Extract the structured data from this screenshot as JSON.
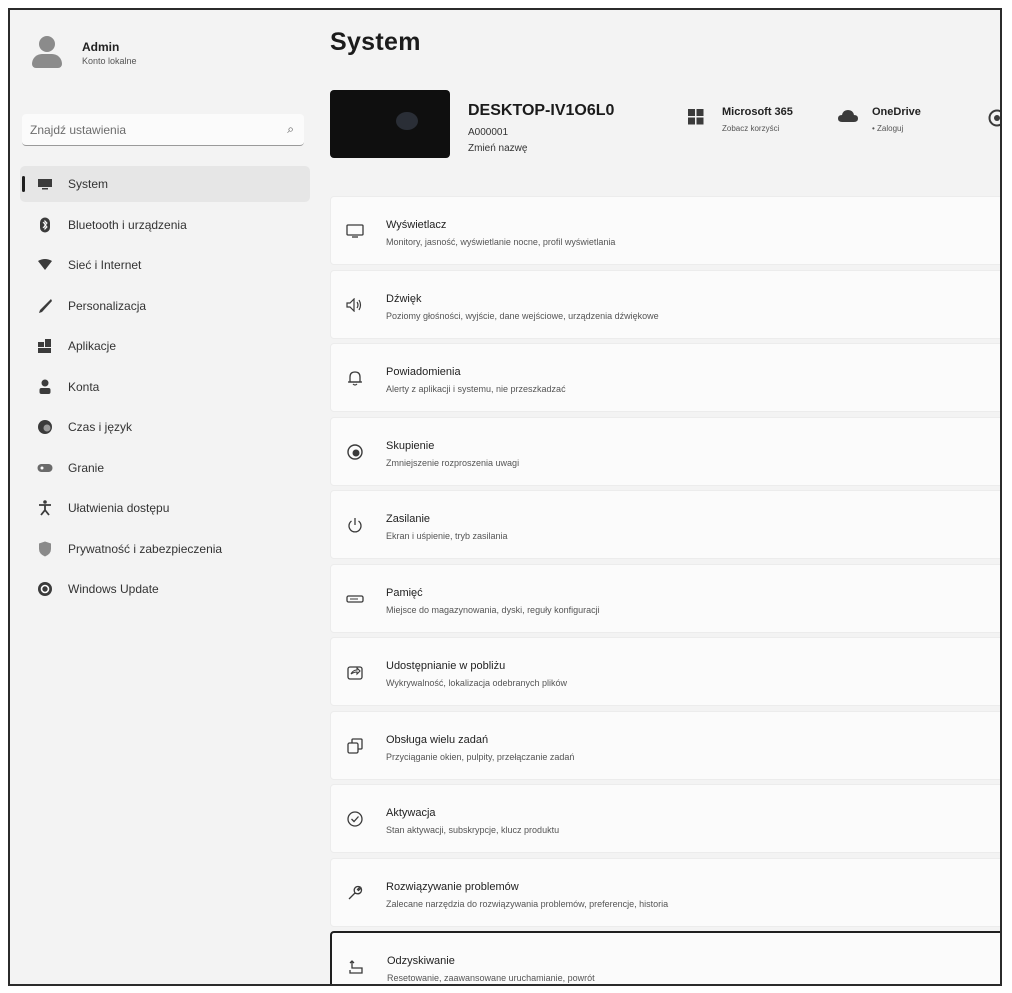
{
  "user": {
    "name": "Admin",
    "account": "Konto lokalne"
  },
  "search": {
    "placeholder": "Znajdź ustawienia"
  },
  "sidebar": {
    "items": [
      {
        "label": "System",
        "icon": "monitor-icon"
      },
      {
        "label": "Bluetooth i urządzenia",
        "icon": "bluetooth-icon"
      },
      {
        "label": "Sieć i Internet",
        "icon": "wifi-icon"
      },
      {
        "label": "Personalizacja",
        "icon": "brush-icon"
      },
      {
        "label": "Aplikacje",
        "icon": "apps-icon"
      },
      {
        "label": "Konta",
        "icon": "person-icon"
      },
      {
        "label": "Czas i język",
        "icon": "globe-clock-icon"
      },
      {
        "label": "Granie",
        "icon": "gamepad-icon"
      },
      {
        "label": "Ułatwienia dostępu",
        "icon": "accessibility-icon"
      },
      {
        "label": "Prywatność i zabezpieczenia",
        "icon": "shield-icon"
      },
      {
        "label": "Windows Update",
        "icon": "update-icon"
      }
    ]
  },
  "main": {
    "title": "System",
    "device": {
      "name": "DESKTOP-IV1O6L0",
      "id": "A000001",
      "rename": "Zmień nazwę"
    },
    "tiles": [
      {
        "title": "Microsoft 365",
        "sub": "Zobacz korzyści",
        "icon": "windows-logo-icon"
      },
      {
        "title": "OneDrive",
        "sub": "• Zaloguj",
        "icon": "cloud-icon"
      }
    ],
    "settings": [
      {
        "title": "Wyświetlacz",
        "sub": "Monitory, jasność, wyświetlanie nocne, profil wyświetlania",
        "icon": "display-icon"
      },
      {
        "title": "Dźwięk",
        "sub": "Poziomy głośności, wyjście, dane wejściowe, urządzenia dźwiękowe",
        "icon": "speaker-icon"
      },
      {
        "title": "Powiadomienia",
        "sub": "Alerty z aplikacji i systemu, nie przeszkadzać",
        "icon": "bell-icon"
      },
      {
        "title": "Skupienie",
        "sub": "Zmniejszenie rozproszenia uwagi",
        "icon": "focus-icon"
      },
      {
        "title": "Zasilanie",
        "sub": "Ekran i uśpienie, tryb zasilania",
        "icon": "power-icon"
      },
      {
        "title": "Pamięć",
        "sub": "Miejsce do magazynowania, dyski, reguły konfiguracji",
        "icon": "storage-icon"
      },
      {
        "title": "Udostępnianie w pobliżu",
        "sub": "Wykrywalność, lokalizacja odebranych plików",
        "icon": "nearby-share-icon"
      },
      {
        "title": "Obsługa wielu zadań",
        "sub": "Przyciąganie okien, pulpity, przełączanie zadań",
        "icon": "multitasking-icon"
      },
      {
        "title": "Aktywacja",
        "sub": "Stan aktywacji, subskrypcje, klucz produktu",
        "icon": "check-circle-icon"
      },
      {
        "title": "Rozwiązywanie problemów",
        "sub": "Zalecane narzędzia do rozwiązywania problemów, preferencje, historia",
        "icon": "wrench-icon"
      },
      {
        "title": "Odzyskiwanie",
        "sub": "Resetowanie, zaawansowane uruchamianie, powrót",
        "icon": "recovery-icon"
      }
    ]
  }
}
